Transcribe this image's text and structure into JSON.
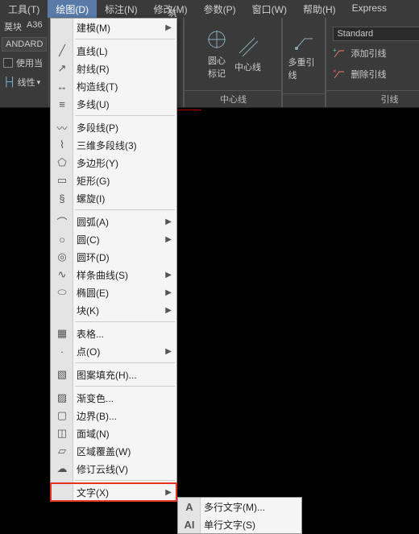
{
  "menubar": {
    "tools": "工具(T)",
    "draw": "绘图(D)",
    "annotate": "标注(N)",
    "modify": "修改(M)",
    "param": "参数(P)",
    "window": "窗口(W)",
    "help": "帮助(H)",
    "express": "Express"
  },
  "ribbon": {
    "left_top1": "莫块",
    "left_top2": "A36",
    "andard": "ANDARD",
    "use_current": "使用当",
    "linetype": "线性",
    "arch_tab": "筑",
    "center_panel": {
      "circle_mark": "圆心\n标记",
      "centerline": "中心线",
      "multileader": "多重引线",
      "title": "中心线"
    },
    "leader_panel": {
      "standard": "Standard",
      "add_leader": "添加引线",
      "remove_leader": "删除引线",
      "title": "引线"
    }
  },
  "dropdown": {
    "model": "建模(M)",
    "line": "直线(L)",
    "ray": "射线(R)",
    "xline": "构造线(T)",
    "mline": "多线(U)",
    "pline": "多段线(P)",
    "pline3d": "三维多段线(3)",
    "polygon": "多边形(Y)",
    "rect": "矩形(G)",
    "helix": "螺旋(I)",
    "arc": "圆弧(A)",
    "circle": "圆(C)",
    "donut": "圆环(D)",
    "spline": "样条曲线(S)",
    "ellipse": "椭圆(E)",
    "block": "块(K)",
    "table": "表格...",
    "point": "点(O)",
    "hatch": "图案填充(H)...",
    "gradient": "渐变色...",
    "boundary": "边界(B)...",
    "region": "面域(N)",
    "wipeout": "区域覆盖(W)",
    "revcloud": "修订云线(V)",
    "text": "文字(X)"
  },
  "submenu": {
    "mtext": "多行文字(M)...",
    "dtext": "单行文字(S)"
  }
}
